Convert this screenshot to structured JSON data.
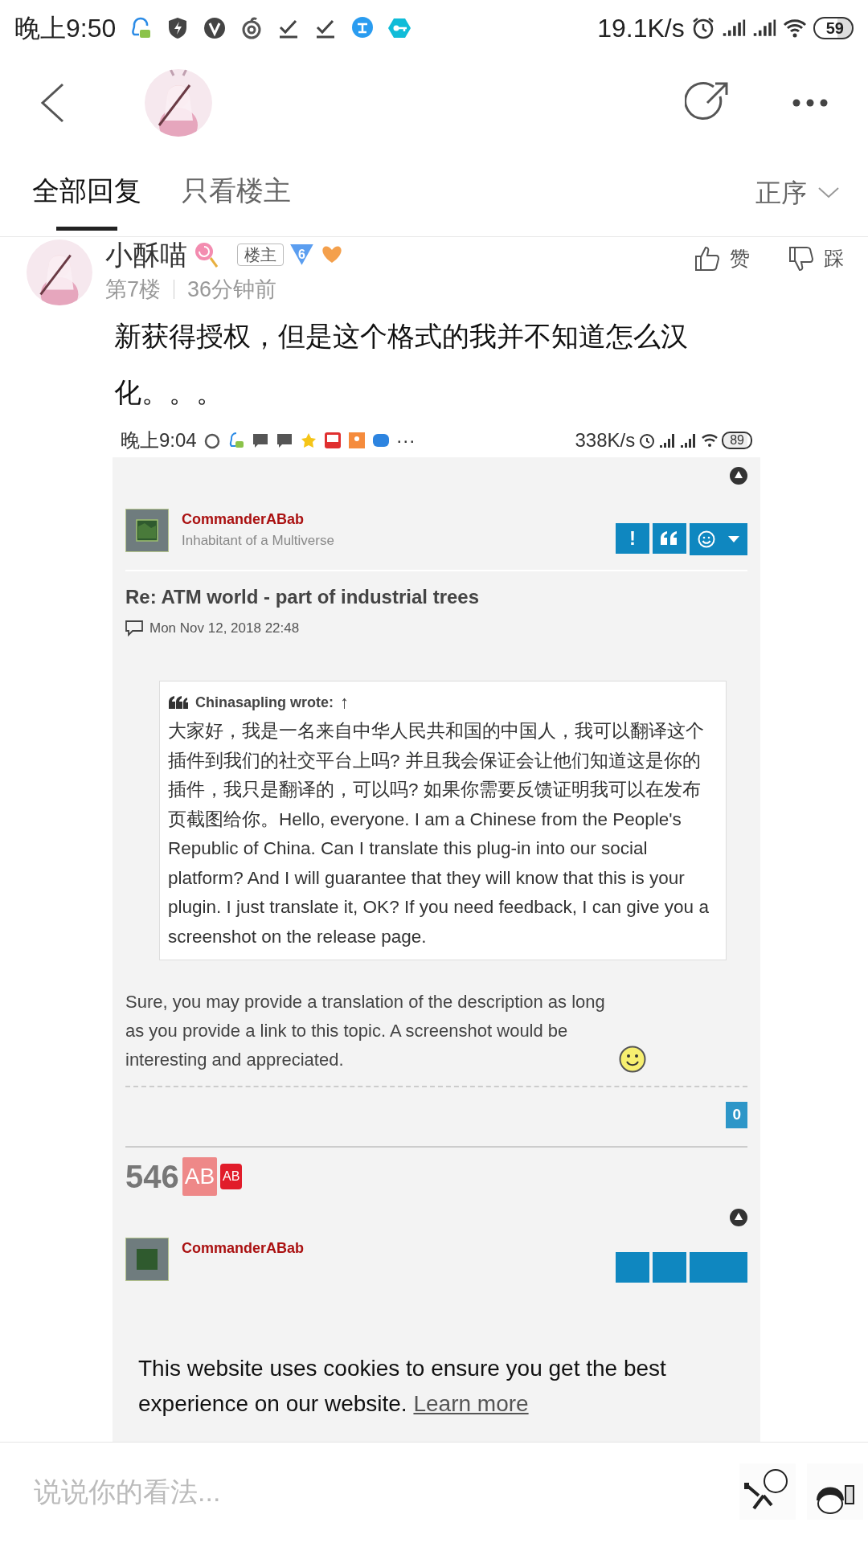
{
  "status_bar": {
    "time": "晚上9:50",
    "speed": "19.1K/s",
    "battery": "59"
  },
  "tabs": [
    {
      "label": "全部回复",
      "selected": true
    },
    {
      "label": "只看楼主",
      "selected": false
    }
  ],
  "sort": {
    "label": "正序"
  },
  "post": {
    "author": "小酥喵",
    "author_badge": "楼主",
    "level": "6",
    "floor": "第7楼",
    "time": "36分钟前",
    "like_label": "赞",
    "dislike_label": "踩",
    "text": "新获得授权，但是这个格式的我并不知道怎么汉化。。。"
  },
  "screenshot": {
    "status_bar": {
      "time": "晚上9:04",
      "more": "···",
      "speed": "338K/s",
      "battery": "89"
    },
    "post": {
      "author": "CommanderABab",
      "rank": "Inhabitant of a Multiverse",
      "report_button": "!",
      "title": "Re: ATM world - part of industrial trees",
      "date": "Mon Nov 12, 2018 22:48",
      "quote": {
        "author": "Chinasapling wrote:",
        "arrow": "↑",
        "text": "大家好，我是一名来自中华人民共和国的中国人，我可以翻译这个插件到我们的社交平台上吗? 并且我会保证会让他们知道这是你的插件，我只是翻译的，可以吗? 如果你需要反馈证明我可以在发布页截图给你。Hello, everyone. I am a Chinese from the People's Republic of China. Can I translate this plug-in into our social platform? And I will guarantee that they will know that this is your plugin. I just translate it, OK? If you need feedback, I can give you a screenshot on the release page."
      },
      "body": "Sure, you may provide a translation of the description as long as you provide a link to this topic. A screenshot would be interesting and appreciated.",
      "count": "0"
    },
    "signature": {
      "number": "546",
      "tag_large": "AB",
      "tag_small": "AB"
    },
    "next_post": {
      "author": "CommanderABab"
    },
    "cookie": {
      "text": "This website uses cookies to ensure you get the best experience on our website.",
      "link": "Learn more"
    }
  },
  "composer": {
    "placeholder": "说说你的看法..."
  }
}
